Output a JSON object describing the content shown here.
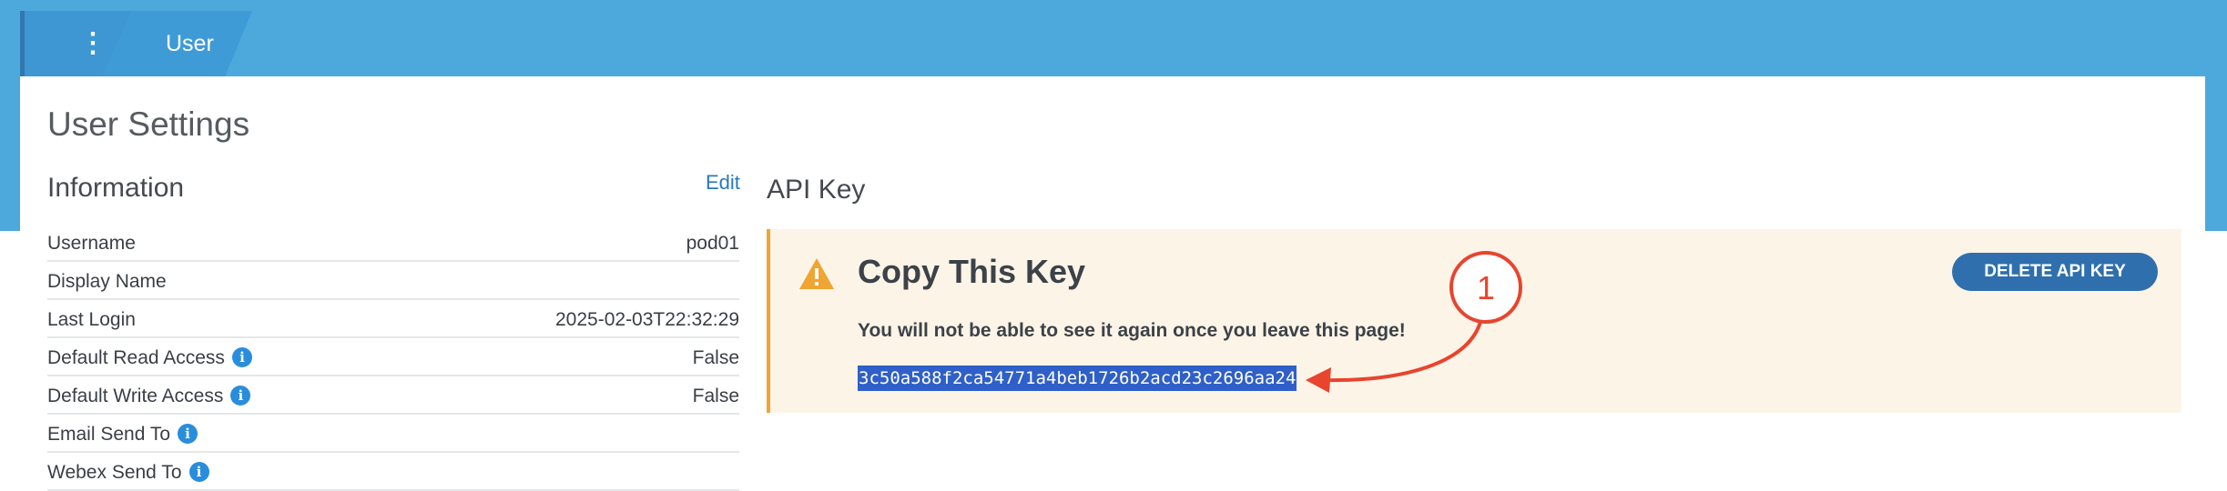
{
  "breadcrumb": {
    "menu_glyph": "⋮",
    "current": "User"
  },
  "page_title": "User Settings",
  "information": {
    "title": "Information",
    "edit_label": "Edit",
    "rows": [
      {
        "label": "Username",
        "value": "pod01",
        "info": false
      },
      {
        "label": "Display Name",
        "value": "",
        "info": false
      },
      {
        "label": "Last Login",
        "value": "2025-02-03T22:32:29",
        "info": false
      },
      {
        "label": "Default Read Access",
        "value": "False",
        "info": true
      },
      {
        "label": "Default Write Access",
        "value": "False",
        "info": true
      },
      {
        "label": "Email Send To",
        "value": "",
        "info": true
      },
      {
        "label": "Webex Send To",
        "value": "",
        "info": true
      }
    ]
  },
  "api_key": {
    "title": "API Key",
    "copy_title": "Copy This Key",
    "warning": "You will not be able to see it again once you leave this page!",
    "key": "3c50a588f2ca54771a4beb1726b2acd23c2696aa24",
    "delete_label": "DELETE API KEY"
  },
  "annotation": {
    "number": "1",
    "color": "#e8442e"
  },
  "colors": {
    "topbar": "#4da9dc",
    "accent": "#2f6fad",
    "warning": "#f0a432"
  }
}
